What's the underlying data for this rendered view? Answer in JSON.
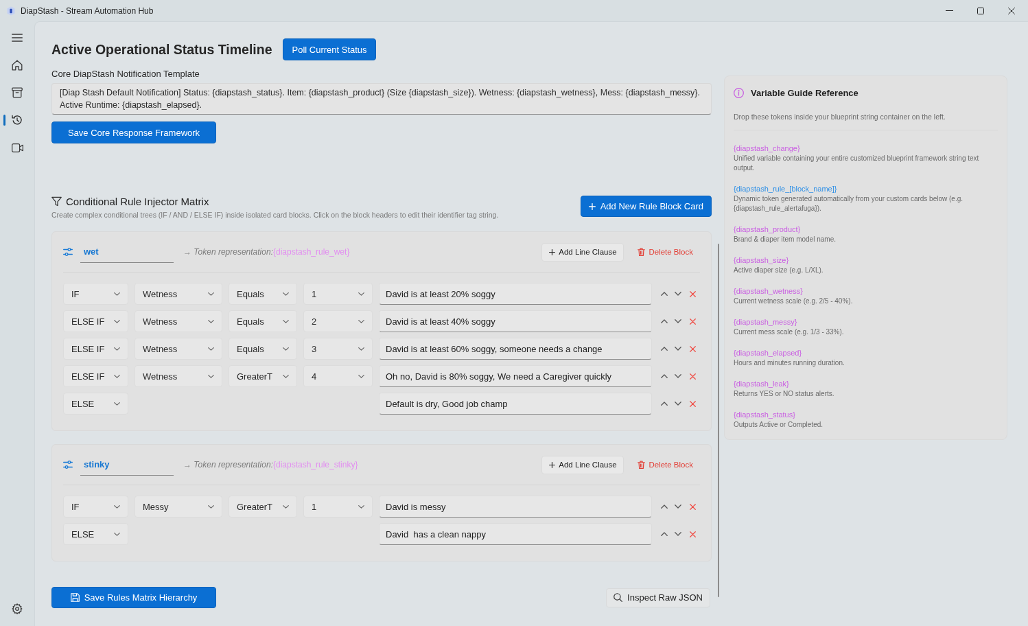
{
  "window": {
    "title": "DiapStash - Stream Automation Hub"
  },
  "nav": {
    "items": [
      {
        "selected": false
      },
      {
        "selected": false
      },
      {
        "selected": true
      },
      {
        "selected": false
      }
    ]
  },
  "header": {
    "title": "Active Operational Status Timeline",
    "poll_button": "Poll Current Status"
  },
  "template": {
    "label": "Core DiapStash Notification Template",
    "value": "[Diap Stash Default Notification] Status: {diapstash_status}. Item: {diapstash_product} (Size {diapstash_size}). Wetness: {diapstash_wetness}, Mess: {diapstash_messy}. Active Runtime: {diapstash_elapsed}.",
    "save_button": "Save Core Response Framework"
  },
  "rules": {
    "title": "Conditional Rule Injector Matrix",
    "subtitle": "Create complex conditional trees (IF / AND / ELSE IF) inside isolated card blocks. Click on the block headers to edit their identifier tag string.",
    "add_button": "Add New Rule Block Card",
    "blocks": [
      {
        "name": "wet",
        "token_label": "→ Token representation:",
        "token": "{diapstash_rule_wet}",
        "add_clause_button": "Add Line Clause",
        "delete_button": "Delete Block",
        "clauses": [
          {
            "kind": "condition",
            "keyword": "IF",
            "field": "Wetness",
            "operator": "Equals",
            "value": "1",
            "text": "David is at least 20% soggy"
          },
          {
            "kind": "condition",
            "keyword": "ELSE IF",
            "field": "Wetness",
            "operator": "Equals",
            "value": "2",
            "text": "David is at least 40% soggy"
          },
          {
            "kind": "condition",
            "keyword": "ELSE IF",
            "field": "Wetness",
            "operator": "Equals",
            "value": "3",
            "text": "David is at least 60% soggy, someone needs a change"
          },
          {
            "kind": "condition",
            "keyword": "ELSE IF",
            "field": "Wetness",
            "operator": "GreaterT",
            "value": "4",
            "text": "Oh no, David is 80% soggy, We need a Caregiver quickly"
          },
          {
            "kind": "else",
            "keyword": "ELSE",
            "text": "Default is dry, Good job champ"
          }
        ]
      },
      {
        "name": "stinky",
        "token_label": "→ Token representation:",
        "token": "{diapstash_rule_stinky}",
        "add_clause_button": "Add Line Clause",
        "delete_button": "Delete Block",
        "clauses": [
          {
            "kind": "condition",
            "keyword": "IF",
            "field": "Messy",
            "operator": "GreaterT",
            "value": "1",
            "text": "David is messy"
          },
          {
            "kind": "else",
            "keyword": "ELSE",
            "text": "David  has a clean nappy"
          }
        ]
      }
    ]
  },
  "footer": {
    "save_button": "Save Rules Matrix Hierarchy",
    "inspect_button": "Inspect Raw JSON"
  },
  "guide": {
    "title": "Variable Guide Reference",
    "intro": "Drop these tokens inside your blueprint string container on the left.",
    "variables": [
      {
        "token": "{diapstash_change}",
        "color": "#c95de2",
        "description": "Unified variable containing your entire customized blueprint framework string text output."
      },
      {
        "token": "{diapstash_rule_[block_name]}",
        "color": "#2d8fe6",
        "description": "Dynamic token generated automatically from your custom cards below (e.g. {diapstash_rule_alertafuga})."
      },
      {
        "token": "{diapstash_product}",
        "color": "#c95de2",
        "description": "Brand & diaper item model name."
      },
      {
        "token": "{diapstash_size}",
        "color": "#c95de2",
        "description": "Active diaper size (e.g. L/XL)."
      },
      {
        "token": "{diapstash_wetness}",
        "color": "#c95de2",
        "description": "Current wetness scale (e.g. 2/5 - 40%)."
      },
      {
        "token": "{diapstash_messy}",
        "color": "#c95de2",
        "description": "Current mess scale (e.g. 1/3 - 33%)."
      },
      {
        "token": "{diapstash_elapsed}",
        "color": "#c95de2",
        "description": "Hours and minutes running duration."
      },
      {
        "token": "{diapstash_leak}",
        "color": "#c95de2",
        "description": "Returns YES or NO status alerts."
      },
      {
        "token": "{diapstash_status}",
        "color": "#c95de2",
        "description": "Outputs Active or Completed."
      }
    ]
  }
}
